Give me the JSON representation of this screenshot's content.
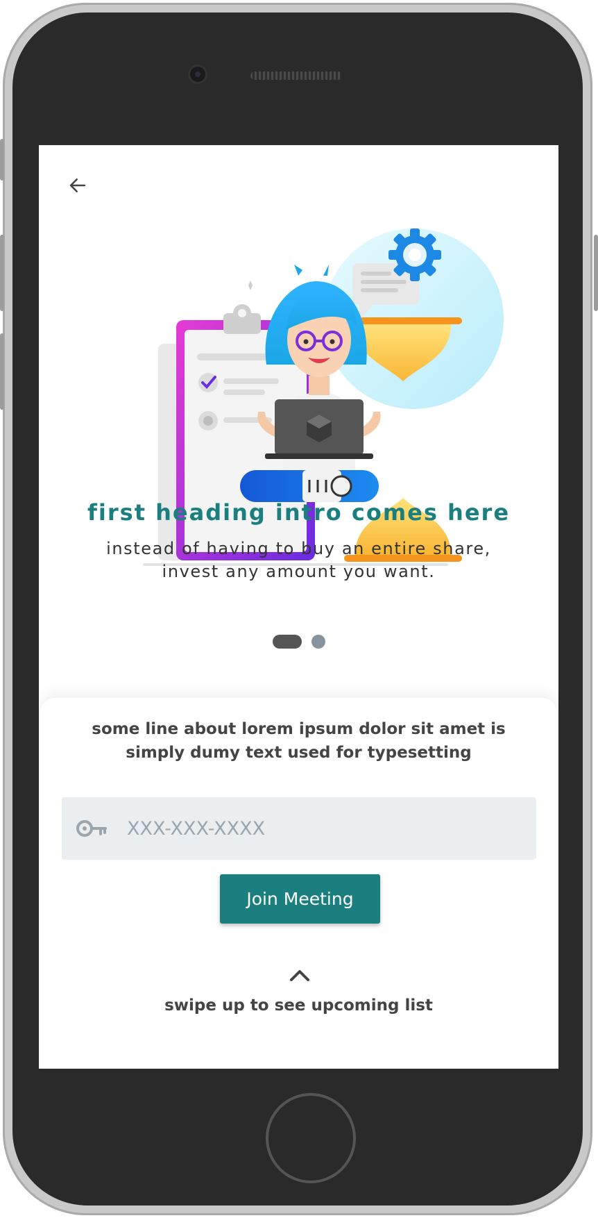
{
  "intro": {
    "heading": "first heading intro comes here",
    "subtitle": "instead of having to buy an entire share, invest any amount you want."
  },
  "pager": {
    "total": 2,
    "active_index": 0
  },
  "join_panel": {
    "description": "some line about lorem ipsum dolor sit amet is simply dumy text used for typesetting",
    "code_input": {
      "placeholder": "XXX-XXX-XXXX",
      "value": ""
    },
    "join_button_label": "Join Meeting",
    "swipe_hint": "swipe up to see upcoming list"
  },
  "icons": {
    "back": "arrow-left-icon",
    "key": "key-icon",
    "swipe": "chevron-up-icon"
  },
  "colors": {
    "accent": "#1b7f80",
    "input_bg": "#ebeef1",
    "dot_active": "#555555",
    "dot_inactive": "#87939c"
  }
}
